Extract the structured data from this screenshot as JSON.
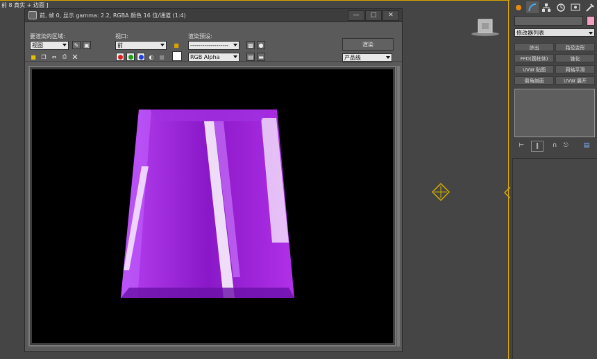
{
  "viewport": {
    "label": "前 8 真实 + 边面 ]"
  },
  "render_window": {
    "title": "前, 帧 0, 显示 gamma: 2.2, RGBA 颜色 16 位/通道 (1:4)",
    "area_label": "要渲染的区域:",
    "area_value": "视图",
    "viewport_label": "视口:",
    "viewport_value": "前",
    "preset_label": "渲染预设:",
    "preset_value": "-------------------",
    "render_button": "渲染",
    "quality_value": "产品级",
    "channel_value": "RGB Alpha"
  },
  "panel": {
    "modifier_list": "修改器列表",
    "buttons": [
      "挤出",
      "路径变形",
      "FFD(圆柱体)",
      "锥化",
      "UVW 贴图",
      "网格平滑",
      "倒角剖面",
      "UVW 展开"
    ]
  },
  "colors": {
    "accent": "#d9a400",
    "object_purple": "#9a1fd0",
    "swatch_pink": "#f2a0c0"
  },
  "icons": [
    "sphere-icon",
    "create-icon",
    "hierarchy-icon",
    "motion-icon",
    "display-icon",
    "utilities-icon"
  ]
}
